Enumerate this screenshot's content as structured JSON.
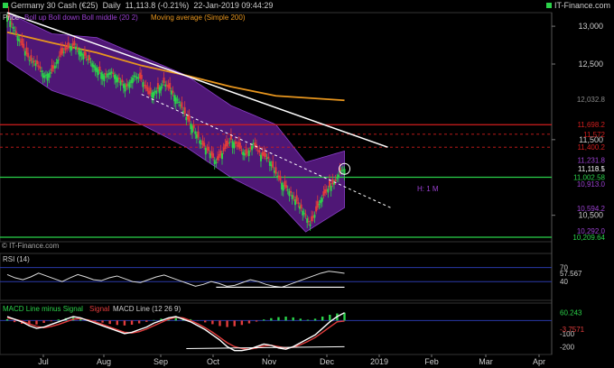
{
  "header": {
    "title": "Germany 30 Cash (€25)",
    "period": "Daily",
    "price": "11,113.8 (-0.21%)",
    "datetime": "22-Jan-2019 09:44:29",
    "brand": "IT-Finance.com"
  },
  "panels": {
    "price_legend": {
      "prefix": "Price",
      "boll": "Boll up Boll down Boll middle (20 2)",
      "ma": "Moving average (Simple 200)"
    },
    "copyright": "© IT-Finance.com",
    "rsi_label": "RSI (14)",
    "macd_label_a": "MACD Line minus Signal",
    "macd_label_b": "Signal",
    "macd_label_c": "MACD Line (12 26 9)"
  },
  "annotations": {
    "high_marker": "H: 1 M"
  },
  "colors": {
    "up": "#2bd24a",
    "down": "#e23c3c",
    "boll": "#6a1f9e",
    "ma": "#e8961e",
    "trend": "#ffffff",
    "resistance": "#d21e1e",
    "support": "#2bd24a"
  },
  "chart_data": [
    {
      "type": "line",
      "title": "Germany 30 Cash (€25) Daily",
      "x_ticks": [
        "Jul",
        "Aug",
        "Sep",
        "Oct",
        "Nov",
        "Dec",
        "2019",
        "Feb",
        "Mar",
        "Apr"
      ],
      "y_ticks": [
        13000,
        12500,
        11500,
        10500
      ],
      "ylim": [
        10150,
        13180
      ],
      "price_labels": [
        {
          "text": "12,032.8",
          "value": 12032.8,
          "color": "#888888"
        },
        {
          "text": "11,698.2",
          "value": 11698.2,
          "color": "#d21e1e"
        },
        {
          "text": "11,572",
          "value": 11572,
          "color": "#d21e1e"
        },
        {
          "text": "11,400.2",
          "value": 11400.2,
          "color": "#d21e1e"
        },
        {
          "text": "11,231.8",
          "value": 11231.8,
          "color": "#9a40d0"
        },
        {
          "text": "11,116.1",
          "value": 11116.1,
          "color": "#cccccc"
        },
        {
          "text": "11,113.5",
          "value": 11113.5,
          "color": "#cccccc"
        },
        {
          "text": "11,002.58",
          "value": 11002.58,
          "color": "#2bd24a"
        },
        {
          "text": "10,913.0",
          "value": 10913,
          "color": "#9a40d0"
        },
        {
          "text": "10,594.2",
          "value": 10594.2,
          "color": "#9a40d0"
        },
        {
          "text": "10,209.64",
          "value": 10209.64,
          "color": "#2bd24a"
        },
        {
          "text": "10,292.0",
          "value": 10292,
          "color": "#9a40d0"
        }
      ],
      "horizontal_levels": [
        {
          "value": 11698.2,
          "style": "solid",
          "color": "#d21e1e"
        },
        {
          "value": 11572,
          "style": "dashed",
          "color": "#d21e1e"
        },
        {
          "value": 11400.2,
          "style": "dashed",
          "color": "#d21e1e"
        },
        {
          "value": 11002.58,
          "style": "solid",
          "color": "#2bd24a"
        },
        {
          "value": 10209.64,
          "style": "solid",
          "color": "#2bd24a"
        }
      ],
      "close_path": [
        [
          0,
          13150
        ],
        [
          5,
          12950
        ],
        [
          10,
          12750
        ],
        [
          15,
          12550
        ],
        [
          20,
          12500
        ],
        [
          25,
          12350
        ],
        [
          30,
          12400
        ],
        [
          35,
          12600
        ],
        [
          40,
          12700
        ],
        [
          45,
          12750
        ],
        [
          50,
          12650
        ],
        [
          55,
          12550
        ],
        [
          60,
          12450
        ],
        [
          65,
          12350
        ],
        [
          70,
          12400
        ],
        [
          75,
          12300
        ],
        [
          80,
          12200
        ],
        [
          85,
          12350
        ],
        [
          90,
          12300
        ],
        [
          95,
          12100
        ],
        [
          100,
          12150
        ],
        [
          105,
          12250
        ],
        [
          110,
          12150
        ],
        [
          115,
          12000
        ],
        [
          120,
          11800
        ],
        [
          125,
          11650
        ],
        [
          130,
          11450
        ],
        [
          135,
          11350
        ],
        [
          140,
          11200
        ],
        [
          145,
          11350
        ],
        [
          150,
          11500
        ],
        [
          155,
          11400
        ],
        [
          160,
          11300
        ],
        [
          165,
          11450
        ],
        [
          170,
          11300
        ],
        [
          175,
          11250
        ],
        [
          180,
          11050
        ],
        [
          185,
          10900
        ],
        [
          190,
          10800
        ],
        [
          195,
          10650
        ],
        [
          200,
          10500
        ],
        [
          203,
          10380
        ],
        [
          207,
          10550
        ],
        [
          210,
          10700
        ],
        [
          215,
          10850
        ],
        [
          220,
          10950
        ],
        [
          223,
          11080
        ],
        [
          226,
          11113.5
        ]
      ],
      "boll_upper": [
        [
          0,
          13180
        ],
        [
          30,
          12900
        ],
        [
          60,
          12850
        ],
        [
          90,
          12600
        ],
        [
          120,
          12350
        ],
        [
          150,
          11950
        ],
        [
          180,
          11700
        ],
        [
          200,
          11200
        ],
        [
          226,
          11350
        ]
      ],
      "boll_lower": [
        [
          0,
          12550
        ],
        [
          30,
          12150
        ],
        [
          60,
          11950
        ],
        [
          90,
          11700
        ],
        [
          120,
          11400
        ],
        [
          150,
          11000
        ],
        [
          180,
          10700
        ],
        [
          200,
          10280
        ],
        [
          226,
          10600
        ]
      ],
      "ma200": [
        [
          0,
          12920
        ],
        [
          30,
          12780
        ],
        [
          60,
          12650
        ],
        [
          90,
          12480
        ],
        [
          120,
          12350
        ],
        [
          150,
          12200
        ],
        [
          180,
          12080
        ],
        [
          226,
          12020
        ]
      ],
      "trendlines": [
        {
          "from": [
            0,
            13180
          ],
          "to": [
            255,
            11400
          ],
          "style": "solid"
        },
        {
          "from": [
            90,
            12100
          ],
          "to": [
            258,
            10590
          ],
          "style": "dashed"
        }
      ]
    },
    {
      "type": "line",
      "title": "RSI (14)",
      "ylim": [
        0,
        100
      ],
      "levels": [
        70,
        40
      ],
      "y_ticks": [
        70,
        40
      ],
      "last_label": "57.567",
      "values": [
        55,
        48,
        44,
        50,
        58,
        52,
        46,
        40,
        48,
        55,
        50,
        44,
        42,
        48,
        52,
        46,
        40,
        38,
        44,
        50,
        54,
        48,
        42,
        36,
        30,
        34,
        40,
        36,
        30,
        32,
        38,
        44,
        40,
        34,
        30,
        28,
        34,
        40,
        46,
        52,
        58,
        62,
        60,
        57.6
      ]
    },
    {
      "type": "bar",
      "title": "MACD (12 26 9)",
      "y_ticks": [
        -100,
        -200
      ],
      "ylim": [
        -260,
        120
      ],
      "labels": [
        "60.243",
        "-3.7571"
      ],
      "histogram": [
        10,
        -12,
        -25,
        -35,
        -30,
        -18,
        -6,
        8,
        18,
        24,
        20,
        10,
        -4,
        -16,
        -26,
        -34,
        -38,
        -32,
        -22,
        -10,
        4,
        14,
        22,
        26,
        20,
        10,
        -2,
        -14,
        -28,
        -42,
        -50,
        -44,
        -34,
        -22,
        -8,
        8,
        18,
        26,
        30,
        24,
        14,
        6,
        14,
        30,
        44,
        54,
        60
      ],
      "macd_line": [
        30,
        10,
        -10,
        -40,
        -60,
        -50,
        -30,
        -10,
        10,
        30,
        20,
        0,
        -20,
        -40,
        -60,
        -80,
        -100,
        -90,
        -70,
        -50,
        -20,
        0,
        20,
        30,
        10,
        -10,
        -40,
        -70,
        -110,
        -150,
        -200,
        -230,
        -230,
        -220,
        -200,
        -180,
        -190,
        -210,
        -220,
        -200,
        -170,
        -140,
        -110,
        -60,
        -10,
        30,
        60
      ],
      "signal_line": [
        20,
        10,
        -5,
        -25,
        -45,
        -55,
        -45,
        -30,
        -10,
        10,
        15,
        5,
        -10,
        -30,
        -50,
        -70,
        -90,
        -95,
        -85,
        -65,
        -40,
        -15,
        10,
        25,
        20,
        0,
        -25,
        -55,
        -90,
        -130,
        -170,
        -200,
        -215,
        -220,
        -210,
        -195,
        -190,
        -200,
        -210,
        -205,
        -185,
        -160,
        -130,
        -90,
        -50,
        -10,
        -3.8
      ]
    }
  ]
}
